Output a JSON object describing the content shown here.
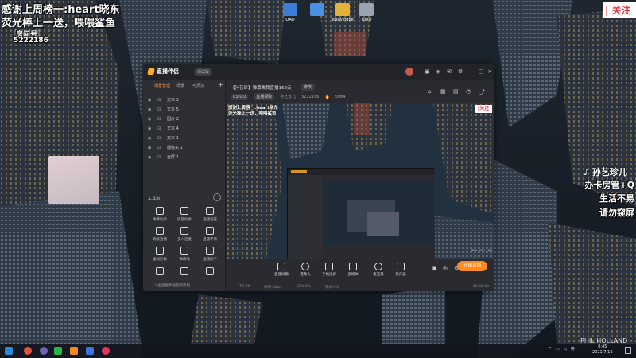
{
  "desktop": {
    "icons": [
      {
        "label": "QAQ",
        "color": "#3b7dd8"
      },
      {
        "label": "",
        "color": "#4a90e2"
      },
      {
        "label": "xiaoyingbe",
        "color": "#e4b23a"
      },
      {
        "label": "QWQ",
        "color": "#9aa4b0"
      }
    ]
  },
  "overlays": {
    "thanks_line1": "感谢上周榜一:heart晓东",
    "thanks_line2": "荧光棒上一送，喂喂鲨鱼",
    "qun_label": "房间号",
    "qun_number": "5222186",
    "follow_label": "| 关注",
    "tiktok_label": "孙艺珍儿",
    "right_notes": [
      "办卡房管+Q",
      "生活不易",
      "请勿窥屏"
    ],
    "watermark": "PHIL HOLLAND"
  },
  "app": {
    "name": "直播伴侣",
    "version_badge": "测试版",
    "scene_tabs": [
      "场景管理",
      "场景",
      "可添加"
    ],
    "add_scene": "+",
    "sources": [
      {
        "type": "folder",
        "label": "文本 3"
      },
      {
        "type": "folder",
        "label": "文本 5"
      },
      {
        "type": "image",
        "label": "图片 2"
      },
      {
        "type": "folder",
        "label": "文本 4"
      },
      {
        "type": "folder",
        "label": "文本 1"
      },
      {
        "type": "camera",
        "label": "摄像头 1"
      },
      {
        "type": "screen",
        "label": "全屏 1"
      }
    ],
    "tools_title": "工具箱",
    "tools_more": "···",
    "tools": [
      {
        "label": "弹幕助手",
        "badge": ""
      },
      {
        "label": "房管助手",
        "badge": ""
      },
      {
        "label": "直播设置",
        "badge": ""
      },
      {
        "label": "等级直播",
        "badge": "免费"
      },
      {
        "label": "多人连麦",
        "badge": ""
      },
      {
        "label": "直播申请",
        "badge": ""
      },
      {
        "label": "虚拟形象",
        "badge": ""
      },
      {
        "label": "弹幕墙",
        "badge": ""
      },
      {
        "label": "直播助手",
        "badge": ""
      },
      {
        "label": "",
        "badge": ""
      },
      {
        "label": "",
        "badge": ""
      },
      {
        "label": "",
        "badge": ""
      }
    ],
    "tip": "斗鱼直播伴侣使用教程",
    "room_title": "【孙艺珍】弹幕教我直播162天",
    "room_tag": "修改",
    "room_info": {
      "level_chip": "CS:GO",
      "category_chip": "直播领取",
      "host": "孙艺珍儿",
      "room_id": "5222186",
      "hot": "5984"
    },
    "preview": {
      "overlay1": "感谢上周榜一:heart晓东",
      "overlay2": "荧光棒上一送，喂喂鲨鱼",
      "follow": "|关注",
      "watermark": "PHIL HOLLAND"
    },
    "controls": [
      "直播屏幕",
      "摄像头",
      "手机投屏",
      "多媒体",
      "麦克风",
      "扬声器"
    ],
    "start_button": "开始直播",
    "status": {
      "fps": "FPS:30",
      "bitrate": "码率:0kb/s",
      "cpu": "CPU:0%",
      "dropped": "丢帧:0%",
      "time": "00:00:00"
    }
  },
  "taskbar": {
    "icons": [
      {
        "name": "windows-icon",
        "color": "#2a8ad6"
      },
      {
        "name": "browser-icon",
        "color": "#e0553f"
      },
      {
        "name": "obs-icon",
        "color": "#6f61b4"
      },
      {
        "name": "wechat-icon",
        "color": "#29b34a"
      },
      {
        "name": "douyu-icon",
        "color": "#f38c1c"
      },
      {
        "name": "media-icon",
        "color": "#3d75d8"
      },
      {
        "name": "record-icon",
        "color": "#e03a5a"
      }
    ],
    "tray_text": "英",
    "clock_time": "0:45",
    "clock_date": "2021/7/16"
  }
}
